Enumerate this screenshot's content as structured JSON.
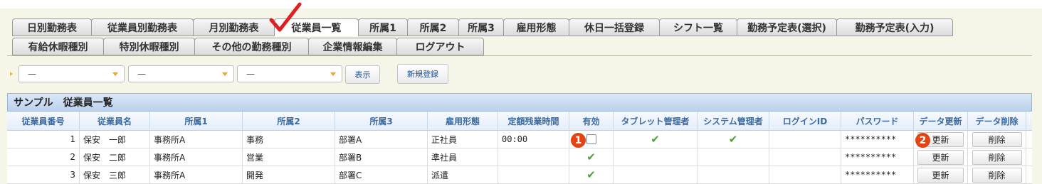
{
  "tabs_row1": [
    "日別勤務表",
    "従業員別勤務表",
    "月別勤務表",
    "従業員一覧",
    "所属1",
    "所属2",
    "所属3",
    "雇用形態",
    "休日一括登録",
    "シフト一覧",
    "勤務予定表(選択)",
    "勤務予定表(入力)"
  ],
  "tabs_row2": [
    "有給休暇種別",
    "特別休暇種別",
    "その他の勤務種別",
    "企業情報編集",
    "ログアウト"
  ],
  "active_tab": "従業員一覧",
  "filters": {
    "select1": "—",
    "select2": "—",
    "select3": "—"
  },
  "buttons": {
    "show": "表示",
    "new": "新規登録"
  },
  "panel_title": "サンプル　従業員一覧",
  "columns": [
    "従業員番号",
    "従業員名",
    "所属1",
    "所属2",
    "所属3",
    "雇用形態",
    "定額残業時間",
    "有効",
    "タブレット管理者",
    "システム管理者",
    "ログインID",
    "パスワード",
    "データ更新",
    "データ削除"
  ],
  "rows": [
    {
      "id": "1",
      "name": "保安　一郎",
      "dept1": "事務所A",
      "dept2": "事務",
      "dept3": "部署A",
      "type": "正社員",
      "overtime": "00:00",
      "valid": "checkbox",
      "tablet": true,
      "system": true,
      "login": "",
      "password": "**********",
      "update": "更新",
      "delete": "削除"
    },
    {
      "id": "2",
      "name": "保安　二郎",
      "dept1": "事務所A",
      "dept2": "営業",
      "dept3": "部署B",
      "type": "準社員",
      "overtime": "",
      "valid": "check",
      "tablet": false,
      "system": false,
      "login": "",
      "password": "**********",
      "update": "更新",
      "delete": "削除"
    },
    {
      "id": "3",
      "name": "保安　三郎",
      "dept1": "事務所A",
      "dept2": "開発",
      "dept3": "部署C",
      "type": "派遣",
      "overtime": "",
      "valid": "check",
      "tablet": false,
      "system": false,
      "login": "",
      "password": "**********",
      "update": "更新",
      "delete": "削除"
    }
  ],
  "annotations": [
    "1",
    "2"
  ],
  "colors": {
    "accent_red": "#e24413",
    "check_green": "#4ea13a",
    "header_blue": "#3b6aa0"
  }
}
